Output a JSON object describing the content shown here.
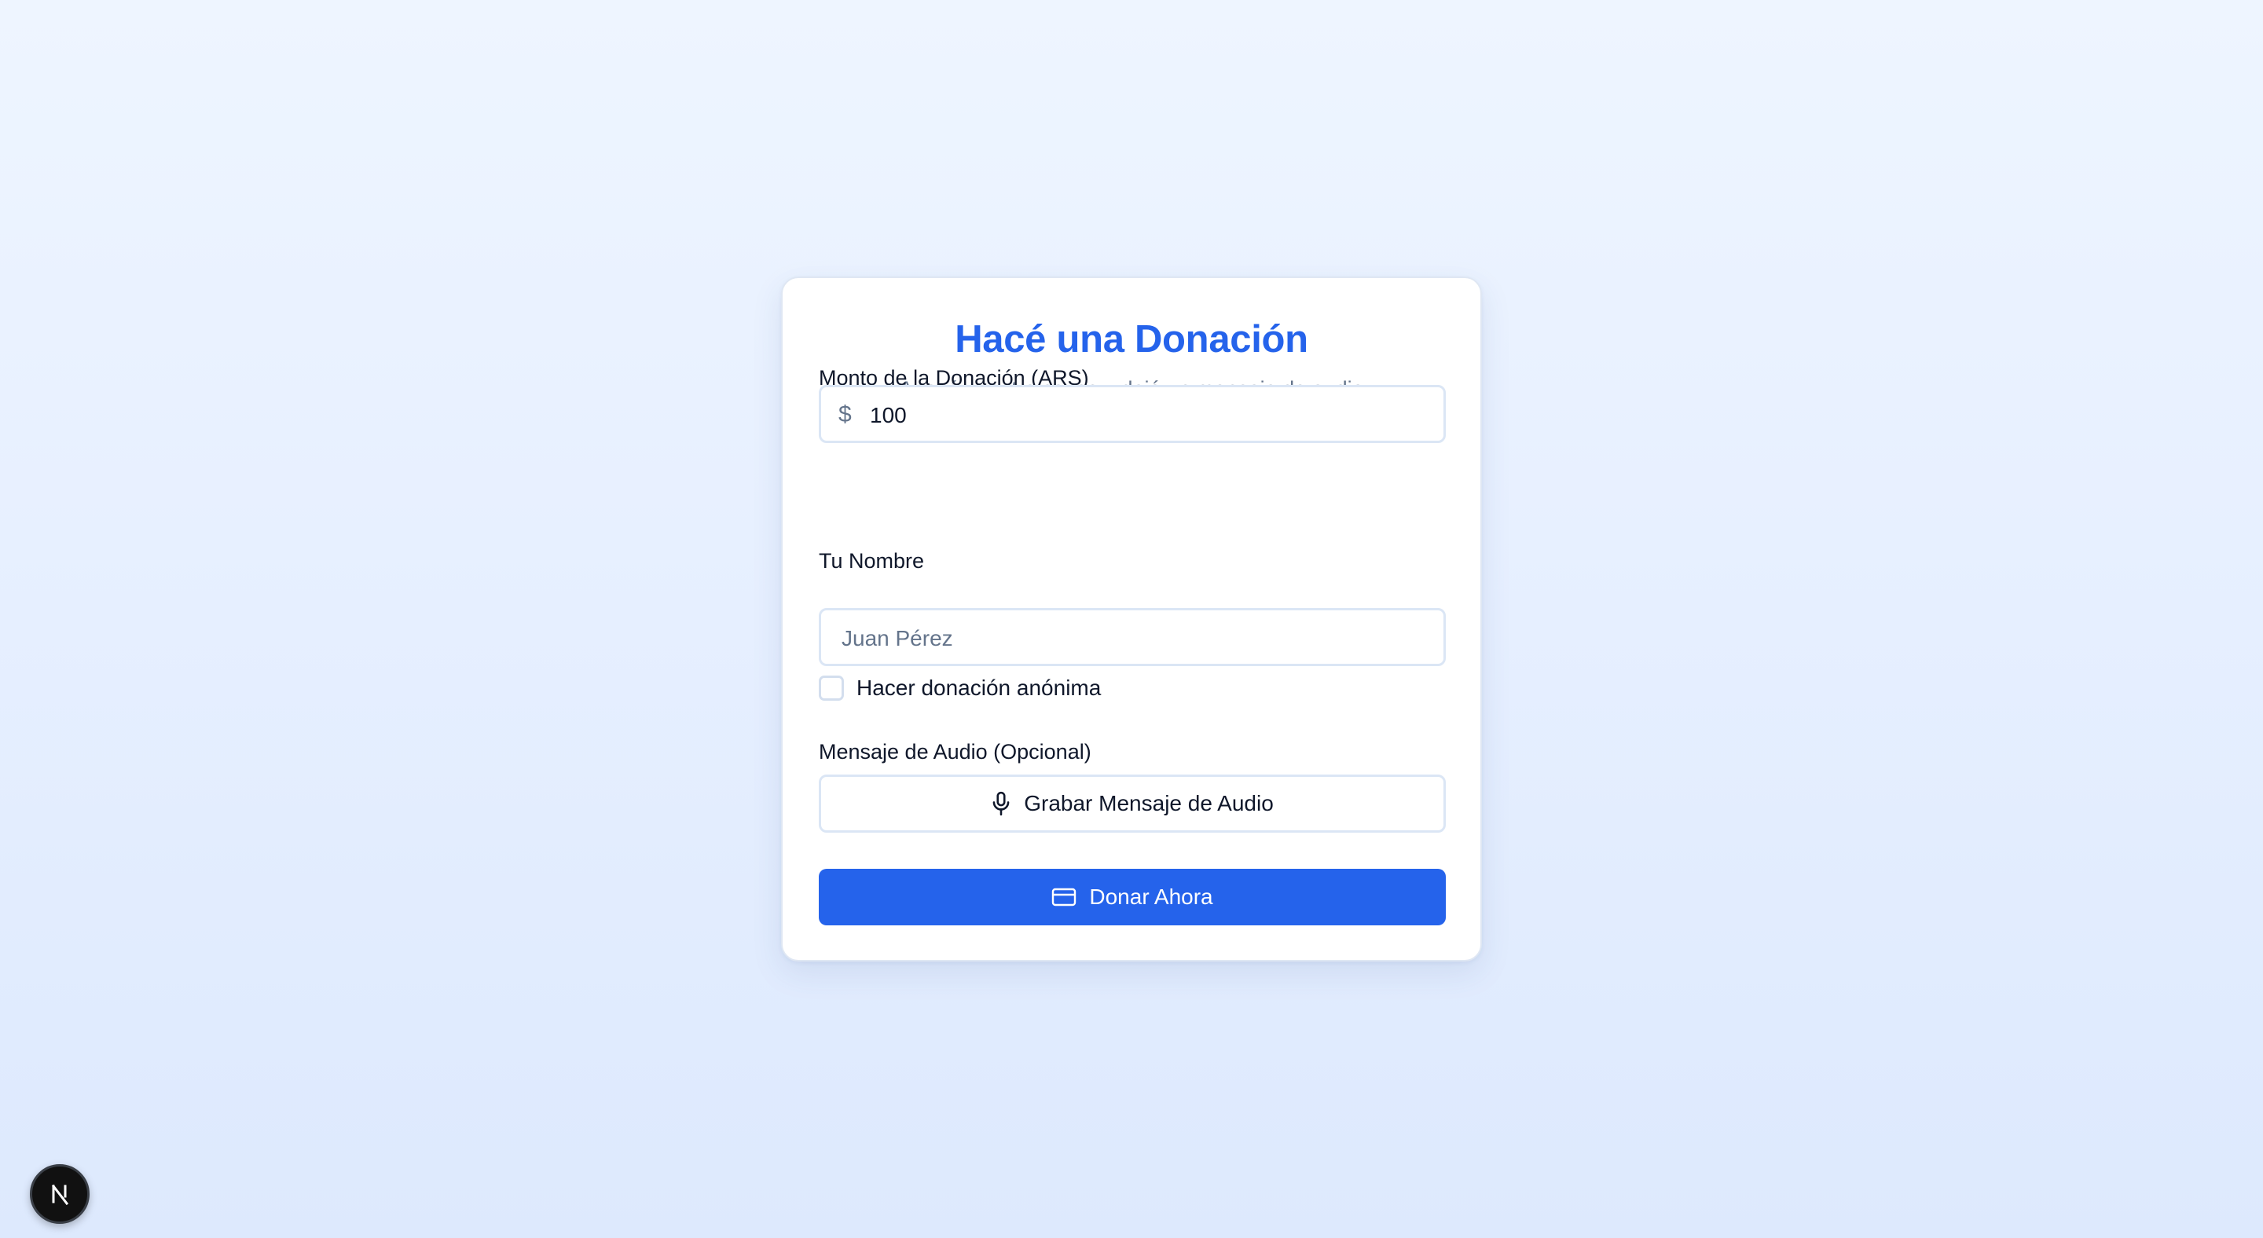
{
  "form": {
    "title": "Hacé una Donación",
    "subtitle": "Apoyá nuestra causa y dejá un mensaje de audio",
    "amount": {
      "label": "Monto de la Donación (ARS)",
      "currency_symbol": "$",
      "value": "100"
    },
    "name": {
      "label": "Tu Nombre",
      "placeholder": "Juan Pérez",
      "value": ""
    },
    "anonymous": {
      "label": "Hacer donación anónima",
      "checked": false
    },
    "audio": {
      "label": "Mensaje de Audio (Opcional)",
      "button_label": "Grabar Mensaje de Audio",
      "icon": "microphone-icon"
    },
    "submit": {
      "label": "Donar Ahora",
      "icon": "credit-card-icon"
    }
  },
  "colors": {
    "accent": "#2563eb",
    "muted_text": "#64748b",
    "text": "#0f172a",
    "border": "#dbe6f5"
  },
  "devtools": {
    "icon": "nextjs-logo-icon"
  }
}
